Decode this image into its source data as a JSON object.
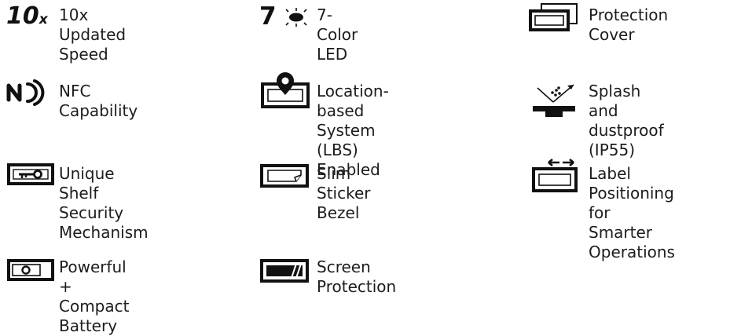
{
  "features": [
    {
      "id": "speed",
      "icon": "10x-speed-icon",
      "label": "10x Updated Speed",
      "badge": "10",
      "badge_suffix": "x"
    },
    {
      "id": "led",
      "icon": "7-color-led-icon",
      "label": "7-Color LED",
      "badge": "7"
    },
    {
      "id": "cover",
      "icon": "protection-cover-icon",
      "label": "Protection\nCover"
    },
    {
      "id": "nfc",
      "icon": "nfc-icon",
      "label": "NFC Capability"
    },
    {
      "id": "lbs",
      "icon": "location-pin-screen-icon",
      "label": "Location-based\nSystem (LBS) Enabled"
    },
    {
      "id": "ip55",
      "icon": "splash-dustproof-icon",
      "label": "Splash and\ndustproof (IP55)"
    },
    {
      "id": "security",
      "icon": "key-lock-icon",
      "label": "Unique Shelf\nSecurity Mechanism"
    },
    {
      "id": "bezel",
      "icon": "slim-sticker-bezel-icon",
      "label": "Slim Sticker Bezel"
    },
    {
      "id": "positioning",
      "icon": "label-positioning-icon",
      "label": "Label Positioning\nfor Smarter\nOperations"
    },
    {
      "id": "battery",
      "icon": "battery-icon",
      "label": "Powerful +\nCompact Battery"
    },
    {
      "id": "screen",
      "icon": "screen-protection-icon",
      "label": "Screen Protection"
    }
  ]
}
